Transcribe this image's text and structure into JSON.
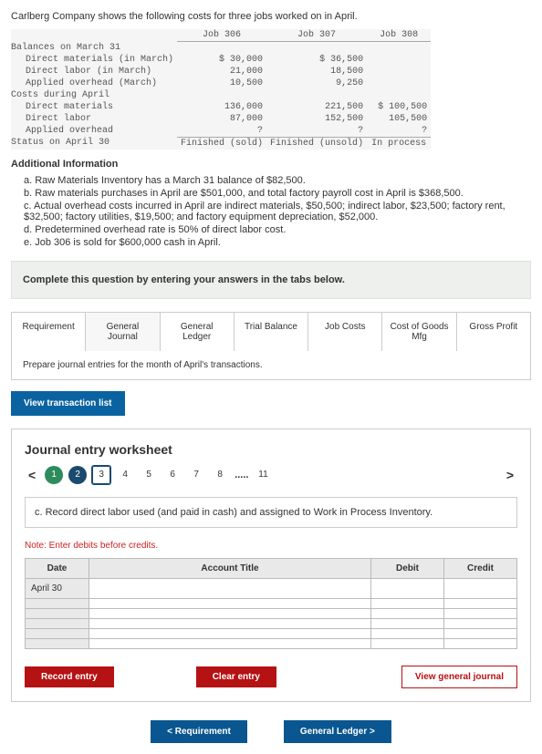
{
  "intro": "Carlberg Company shows the following costs for three jobs worked on in April.",
  "costs": {
    "headers": [
      "Job 306",
      "Job 307",
      "Job 308"
    ],
    "groups": [
      {
        "label": "Balances on March 31",
        "rows": [
          {
            "label": "Direct materials (in March)",
            "vals": [
              "$ 30,000",
              "$ 36,500",
              ""
            ]
          },
          {
            "label": "Direct labor (in March)",
            "vals": [
              "21,000",
              "18,500",
              ""
            ]
          },
          {
            "label": "Applied overhead (March)",
            "vals": [
              "10,500",
              "9,250",
              ""
            ]
          }
        ]
      },
      {
        "label": "Costs during April",
        "rows": [
          {
            "label": "Direct materials",
            "vals": [
              "136,000",
              "221,500",
              "$ 100,500"
            ]
          },
          {
            "label": "Direct labor",
            "vals": [
              "87,000",
              "152,500",
              "105,500"
            ]
          },
          {
            "label": "Applied overhead",
            "vals": [
              "?",
              "?",
              "?"
            ]
          }
        ]
      }
    ],
    "status_label": "Status on April 30",
    "status_vals": [
      "Finished (sold)",
      "Finished (unsold)",
      "In process"
    ]
  },
  "addl_title": "Additional Information",
  "addl": [
    "a. Raw Materials Inventory has a March 31 balance of $82,500.",
    "b. Raw materials purchases in April are $501,000, and total factory payroll cost in April is $368,500.",
    "c. Actual overhead costs incurred in April are indirect materials, $50,500; indirect labor, $23,500; factory rent, $32,500; factory utilities, $19,500; and factory equipment depreciation, $52,000.",
    "d. Predetermined overhead rate is 50% of direct labor cost.",
    "e. Job 306 is sold for $600,000 cash in April."
  ],
  "tab_instr": "Complete this question by entering your answers in the tabs below.",
  "tabs": [
    "Requirement",
    "General Journal",
    "General Ledger",
    "Trial Balance",
    "Job Costs",
    "Cost of Goods Mfg",
    "Gross Profit"
  ],
  "prep": "Prepare journal entries for the month of April's transactions.",
  "view_trans": "View transaction list",
  "ws": {
    "title": "Journal entry worksheet",
    "steps": [
      "1",
      "2",
      "3",
      "4",
      "5",
      "6",
      "7",
      "8",
      ".....",
      "11"
    ],
    "instr": "c. Record direct labor used (and paid in cash) and assigned to Work in Process Inventory.",
    "note": "Note: Enter debits before credits.",
    "headers": [
      "Date",
      "Account Title",
      "Debit",
      "Credit"
    ],
    "date": "April 30",
    "record": "Record entry",
    "clear": "Clear entry",
    "view_gj": "View general journal"
  },
  "nav": {
    "back": "Requirement",
    "next": "General Ledger"
  }
}
